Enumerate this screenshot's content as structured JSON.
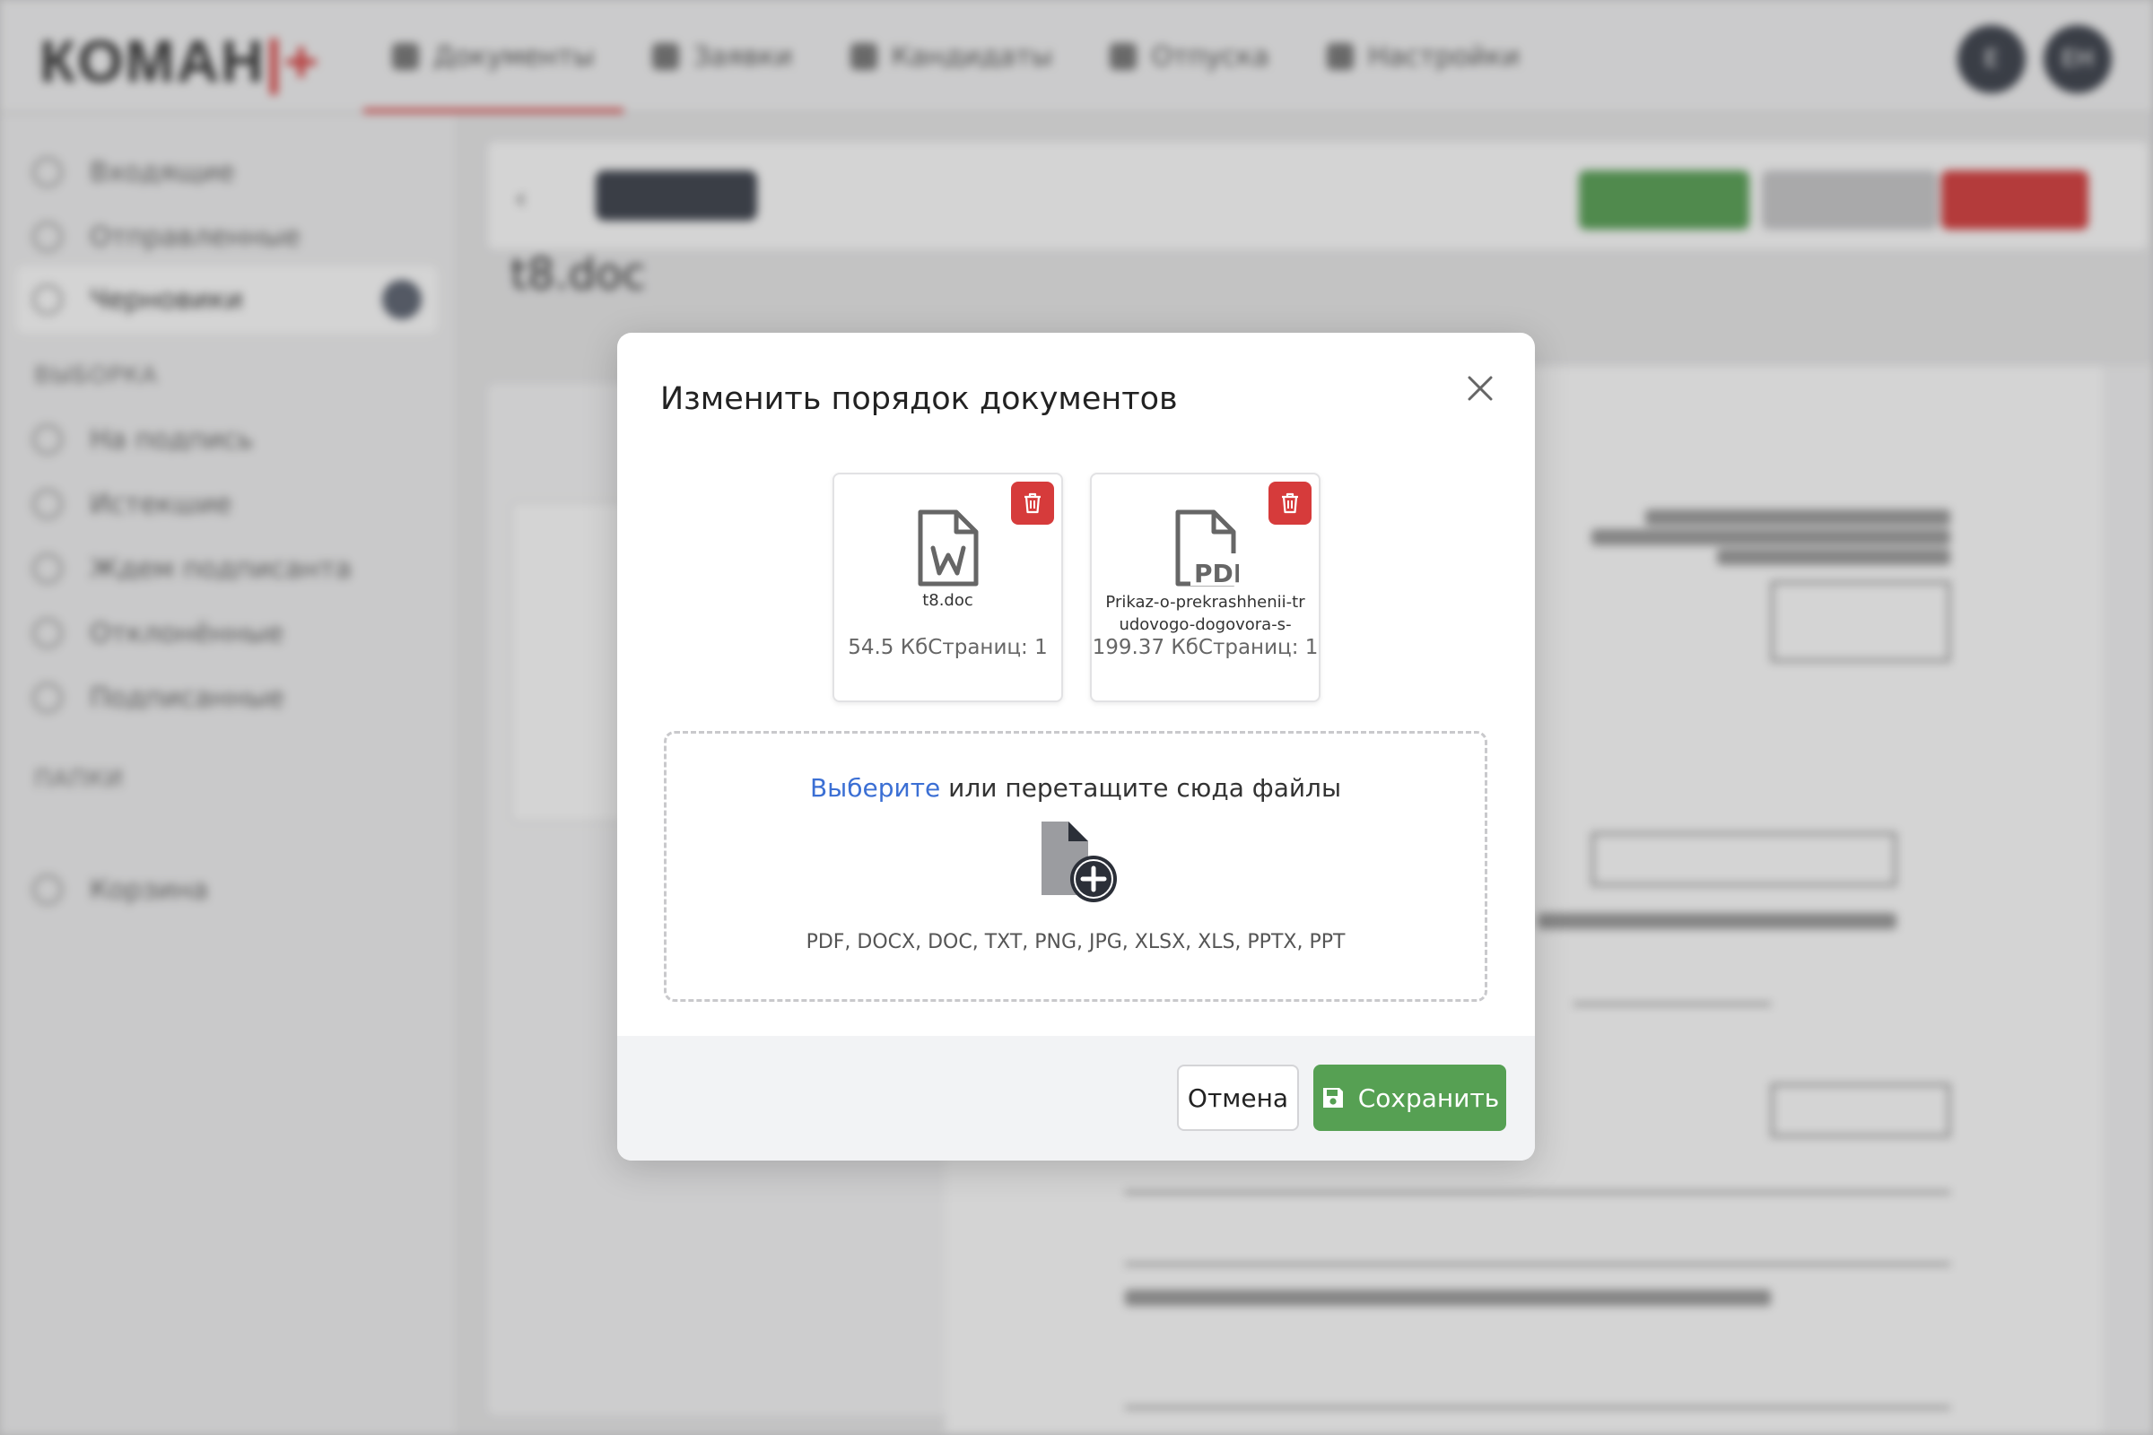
{
  "app": {
    "logo_main": "КОМАН",
    "logo_mark": "|+",
    "nav": [
      {
        "label": "Документы",
        "icon": "document-icon",
        "active": true
      },
      {
        "label": "Заявки",
        "icon": "briefcase-icon"
      },
      {
        "label": "Кандидаты",
        "icon": "user-icon"
      },
      {
        "label": "Отпуска",
        "icon": "palm-icon"
      },
      {
        "label": "Настройки",
        "icon": "settings-icon"
      }
    ],
    "avatars": [
      "Е",
      "ЕН"
    ],
    "sidebar": {
      "items": [
        {
          "label": "Входящие",
          "icon": "inbox-icon"
        },
        {
          "label": "Отправленные",
          "icon": "send-icon"
        },
        {
          "label": "Черновики",
          "icon": "draft-icon",
          "active": true
        }
      ],
      "selection_heading": "ВЫБОРКА",
      "selection_items": [
        {
          "label": "На подпись",
          "icon": "sign-icon"
        },
        {
          "label": "Истекшие",
          "icon": "expired-icon"
        },
        {
          "label": "Ждем подписанта",
          "icon": "clock-icon"
        },
        {
          "label": "Отклонённые",
          "icon": "rejected-icon"
        },
        {
          "label": "Подписанные",
          "icon": "signed-icon"
        }
      ],
      "folders_heading": "ПАПКИ",
      "trash": {
        "label": "Корзина",
        "icon": "trash-icon"
      }
    },
    "doc_title": "t8.doc"
  },
  "modal": {
    "title": "Изменить порядок документов",
    "files": [
      {
        "icon": "word-file-icon",
        "name": "t8.doc",
        "size": "54.5 Кб",
        "pages": "Страниц: 1"
      },
      {
        "icon": "pdf-file-icon",
        "name": "Prikaz-o-prekrashhenii-trudovogo-dogovora-s-",
        "size": "199.37 Кб",
        "pages": "Страниц: 1"
      }
    ],
    "dropzone": {
      "link": "Выберите",
      "text": " или перетащите сюда файлы",
      "formats": "PDF, DOCX, DOC, TXT, PNG, JPG, XLSX, XLS, PPTX, PPT"
    },
    "cancel_label": "Отмена",
    "save_label": "Сохранить",
    "colors": {
      "save": "#56a053",
      "delete": "#d63b3b",
      "link": "#3b6fd4"
    }
  }
}
